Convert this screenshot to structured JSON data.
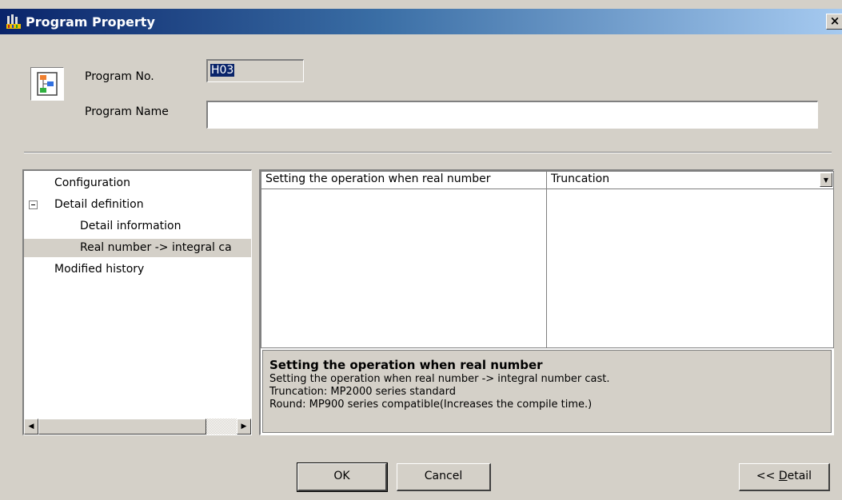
{
  "window": {
    "title": "Program Property",
    "close_glyph": "×"
  },
  "program_no": {
    "label": "Program No.",
    "value": "H03"
  },
  "program_name": {
    "label": "Program Name",
    "value": ""
  },
  "tree": {
    "items": [
      {
        "label": "Configuration",
        "indent": 0
      },
      {
        "label": "Detail definition",
        "indent": 0,
        "expanded": true
      },
      {
        "label": "Detail information",
        "indent": 1
      },
      {
        "label": "Real number -> integral ca",
        "indent": 1,
        "selected": true
      },
      {
        "label": "Modified history",
        "indent": 0
      }
    ],
    "scroll_left_glyph": "◀",
    "scroll_right_glyph": "▶"
  },
  "property_grid": {
    "rows": [
      {
        "name": "Setting the operation when real number",
        "value": "Truncation"
      }
    ],
    "dropdown_glyph": "▼"
  },
  "description": {
    "title": "Setting the operation when real number",
    "lines": [
      "Setting the operation when real number -> integral number cast.",
      "Truncation: MP2000 series standard",
      "Round: MP900 series compatible(Increases the compile time.)"
    ]
  },
  "buttons": {
    "ok": "OK",
    "cancel": "Cancel",
    "detail_prefix": "<< ",
    "detail_underlined": "D",
    "detail_rest": "etail"
  },
  "colors": {
    "titlebar_start": "#0a246a",
    "titlebar_end": "#a6caf0",
    "face": "#d4d0c8",
    "selection": "#0a246a"
  }
}
